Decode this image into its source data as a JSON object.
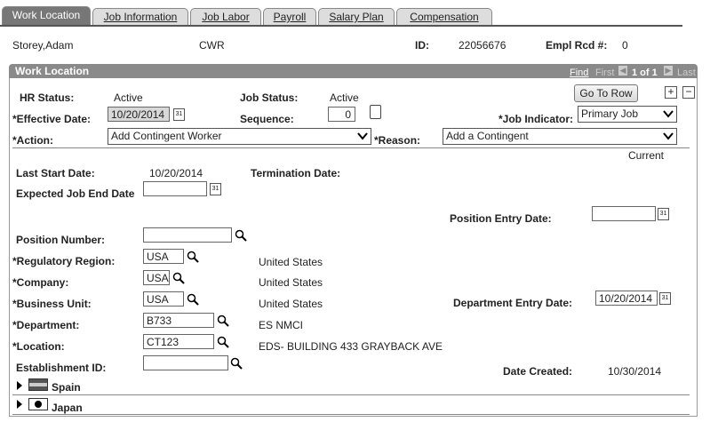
{
  "tabs": [
    {
      "label": "Work Location",
      "active": true
    },
    {
      "label": "Job Information"
    },
    {
      "label": "Job Labor"
    },
    {
      "label": "Payroll"
    },
    {
      "label": "Salary Plan"
    },
    {
      "label": "Compensation"
    }
  ],
  "header": {
    "name": "Storey,Adam",
    "type": "CWR",
    "id_label": "ID:",
    "id_value": "22056676",
    "empl_rcd_label": "Empl Rcd #:",
    "empl_rcd_value": "0"
  },
  "section": {
    "title": "Work Location",
    "find": "Find",
    "first": "First",
    "pager": "1 of 1",
    "last": "Last"
  },
  "row1": {
    "hr_status_label": "HR Status:",
    "hr_status": "Active",
    "job_status_label": "Job Status:",
    "job_status": "Active",
    "go_to_row": "Go To Row",
    "add": "+",
    "remove": "−"
  },
  "row2": {
    "eff_date_label": "*Effective Date:",
    "eff_date": "10/20/2014",
    "sequence_label": "Sequence:",
    "sequence": "0",
    "job_indicator_label": "*Job Indicator:",
    "job_indicator": "Primary Job"
  },
  "row3": {
    "action_label": "*Action:",
    "action": "Add Contingent Worker",
    "reason_label": "*Reason:",
    "reason": "Add a Contingent",
    "current": "Current"
  },
  "dates": {
    "last_start_label": "Last Start Date:",
    "last_start": "10/20/2014",
    "termination_label": "Termination Date:",
    "expected_end_label": "Expected Job End Date",
    "position_entry_label": "Position Entry Date:"
  },
  "fields": {
    "position_number_label": "Position Number:",
    "regulatory_label": "*Regulatory Region:",
    "regulatory": "USA",
    "regulatory_desc": "United States",
    "company_label": "*Company:",
    "company": "USA",
    "company_desc": "United States",
    "bu_label": "*Business Unit:",
    "bu": "USA",
    "bu_desc": "United States",
    "dept_entry_label": "Department Entry Date:",
    "dept_entry": "10/20/2014",
    "dept_label": "*Department:",
    "dept": "B733",
    "dept_desc": "ES NMCI",
    "location_label": "*Location:",
    "location": "CT123",
    "location_desc": "EDS- BUILDING 433 GRAYBACK AVE",
    "establishment_label": "Establishment ID:",
    "date_created_label": "Date Created:",
    "date_created": "10/30/2014"
  },
  "countries": [
    {
      "name": "Spain"
    },
    {
      "name": "Japan"
    }
  ],
  "colors": {
    "tab_active": "#777777",
    "section_header": "#8a8a8a"
  }
}
